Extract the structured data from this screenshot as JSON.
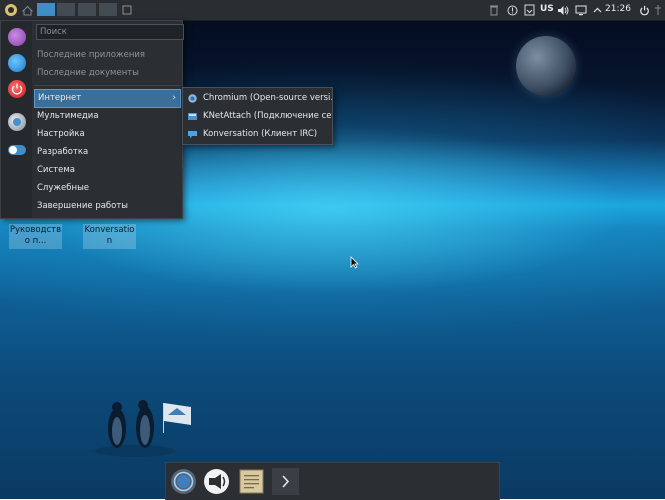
{
  "panel": {
    "clock": "21:26",
    "keyboard_layout": "US"
  },
  "menu": {
    "search_placeholder": "Поиск",
    "recent_apps": "Последние приложения",
    "recent_docs": "Последние документы",
    "categories": [
      {
        "label": "Интернет",
        "arrow": "›"
      },
      {
        "label": "Мультимедиа"
      },
      {
        "label": "Настройка"
      },
      {
        "label": "Разработка"
      },
      {
        "label": "Система"
      },
      {
        "label": "Служебные"
      },
      {
        "label": "Завершение работы"
      }
    ]
  },
  "submenu": {
    "items": [
      {
        "label": "Chromium (Open-source versi…",
        "icon": "chromium-icon"
      },
      {
        "label": "KNetAttach (Подключение сет…",
        "icon": "knetattach-icon"
      },
      {
        "label": "Konversation (Клиент IRC)",
        "icon": "konversation-icon"
      }
    ]
  },
  "desktop": {
    "icons": [
      {
        "label": "Руководств о п..."
      },
      {
        "label": "Konversatio n"
      }
    ]
  },
  "colors": {
    "panel_bg": "#2a2e33",
    "accent": "#3d8ec9",
    "highlight": "#3b6e99"
  }
}
